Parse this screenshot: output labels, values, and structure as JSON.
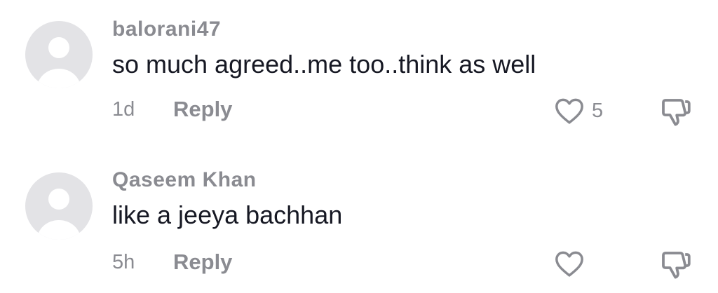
{
  "comments": [
    {
      "username": "balorani47",
      "text": "so much agreed..me too..think as well",
      "time": "1d",
      "reply_label": "Reply",
      "like_icon": "heart-outline",
      "like_count": "5",
      "dislike_icon": "thumbs-down-outline"
    },
    {
      "username": "Qaseem Khan",
      "text": "like a jeeya bachhan",
      "time": "5h",
      "reply_label": "Reply",
      "like_icon": "heart-outline",
      "like_count": "",
      "dislike_icon": "thumbs-down-outline"
    }
  ],
  "colors": {
    "muted_text": "#8a8b91",
    "primary_text": "#161823",
    "avatar_bg": "#e3e3e6",
    "avatar_fg": "#ffffff"
  }
}
